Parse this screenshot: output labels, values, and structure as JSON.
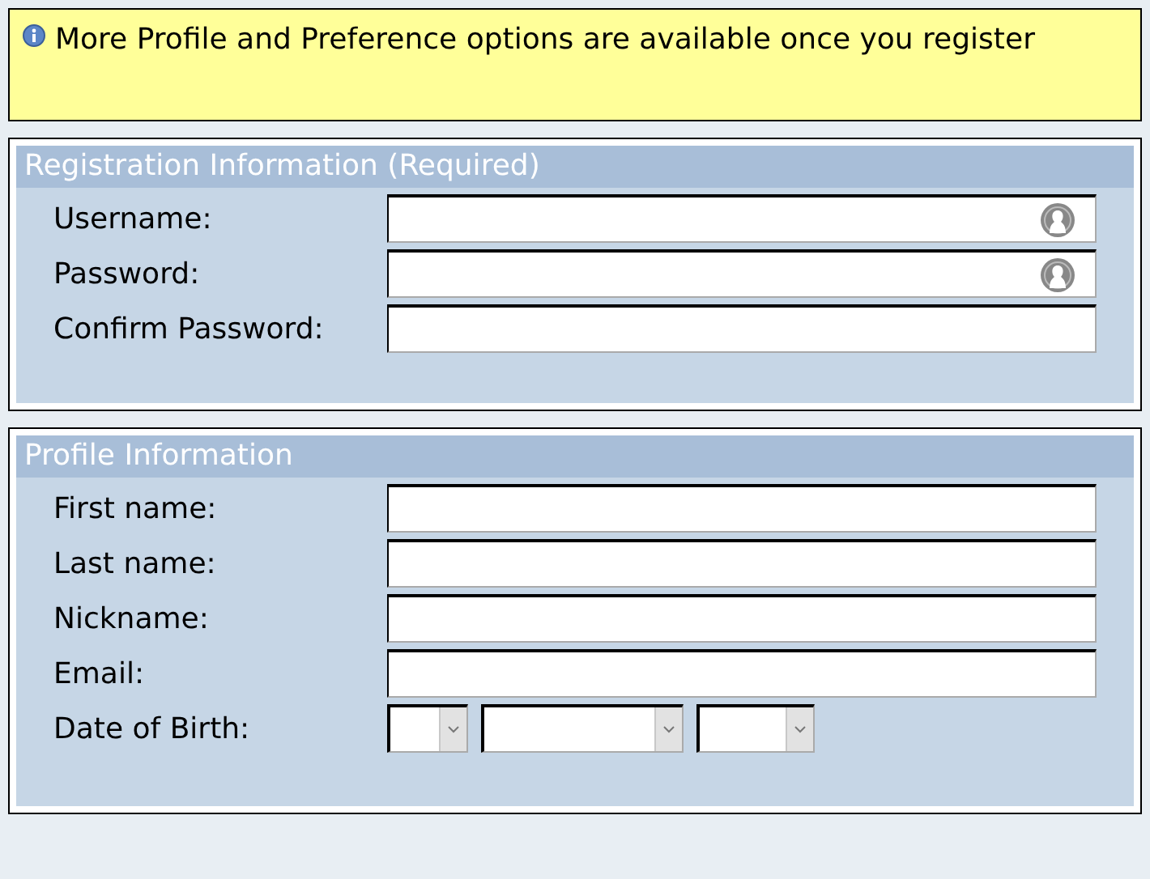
{
  "notice": {
    "text": "More Profile and Preference options are available once you register"
  },
  "sections": [
    {
      "title": "Registration Information (Required)",
      "fields": [
        {
          "label": "Username:",
          "kind": "text-icon"
        },
        {
          "label": "Password:",
          "kind": "text-icon"
        },
        {
          "label": "Confirm Password:",
          "kind": "text"
        }
      ]
    },
    {
      "title": "Profile Information",
      "fields": [
        {
          "label": "First name:",
          "kind": "text"
        },
        {
          "label": "Last name:",
          "kind": "text"
        },
        {
          "label": "Nickname:",
          "kind": "text"
        },
        {
          "label": "Email:",
          "kind": "text"
        },
        {
          "label": "Date of Birth:",
          "kind": "date"
        }
      ]
    }
  ]
}
